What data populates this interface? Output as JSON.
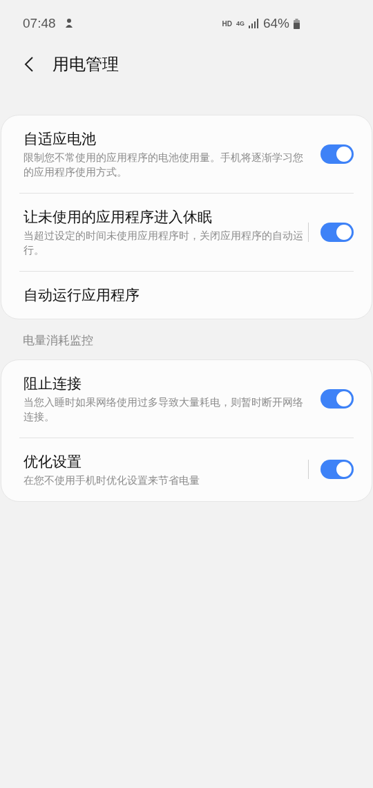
{
  "status_bar": {
    "time": "07:48",
    "hd": "HD",
    "network": "4G",
    "battery": "64%"
  },
  "header": {
    "title": "用电管理"
  },
  "groups": [
    {
      "items": [
        {
          "kind": "toggle",
          "title": "自适应电池",
          "description": "限制您不常使用的应用程序的电池使用量。手机将逐渐学习您的应用程序使用方式。",
          "on": true,
          "separator": false
        },
        {
          "kind": "toggle",
          "title": "让未使用的应用程序进入休眠",
          "description": "当超过设定的时间未使用应用程序时，关闭应用程序的自动运行。",
          "on": true,
          "separator": true
        },
        {
          "kind": "link",
          "title": "自动运行应用程序"
        }
      ]
    },
    {
      "heading": "电量消耗监控",
      "items": [
        {
          "kind": "toggle",
          "title": "阻止连接",
          "description": "当您入睡时如果网络使用过多导致大量耗电，则暂时断开网络连接。",
          "on": true,
          "separator": false
        },
        {
          "kind": "toggle",
          "title": "优化设置",
          "description": "在您不使用手机时优化设置来节省电量",
          "on": true,
          "separator": true
        }
      ]
    }
  ]
}
